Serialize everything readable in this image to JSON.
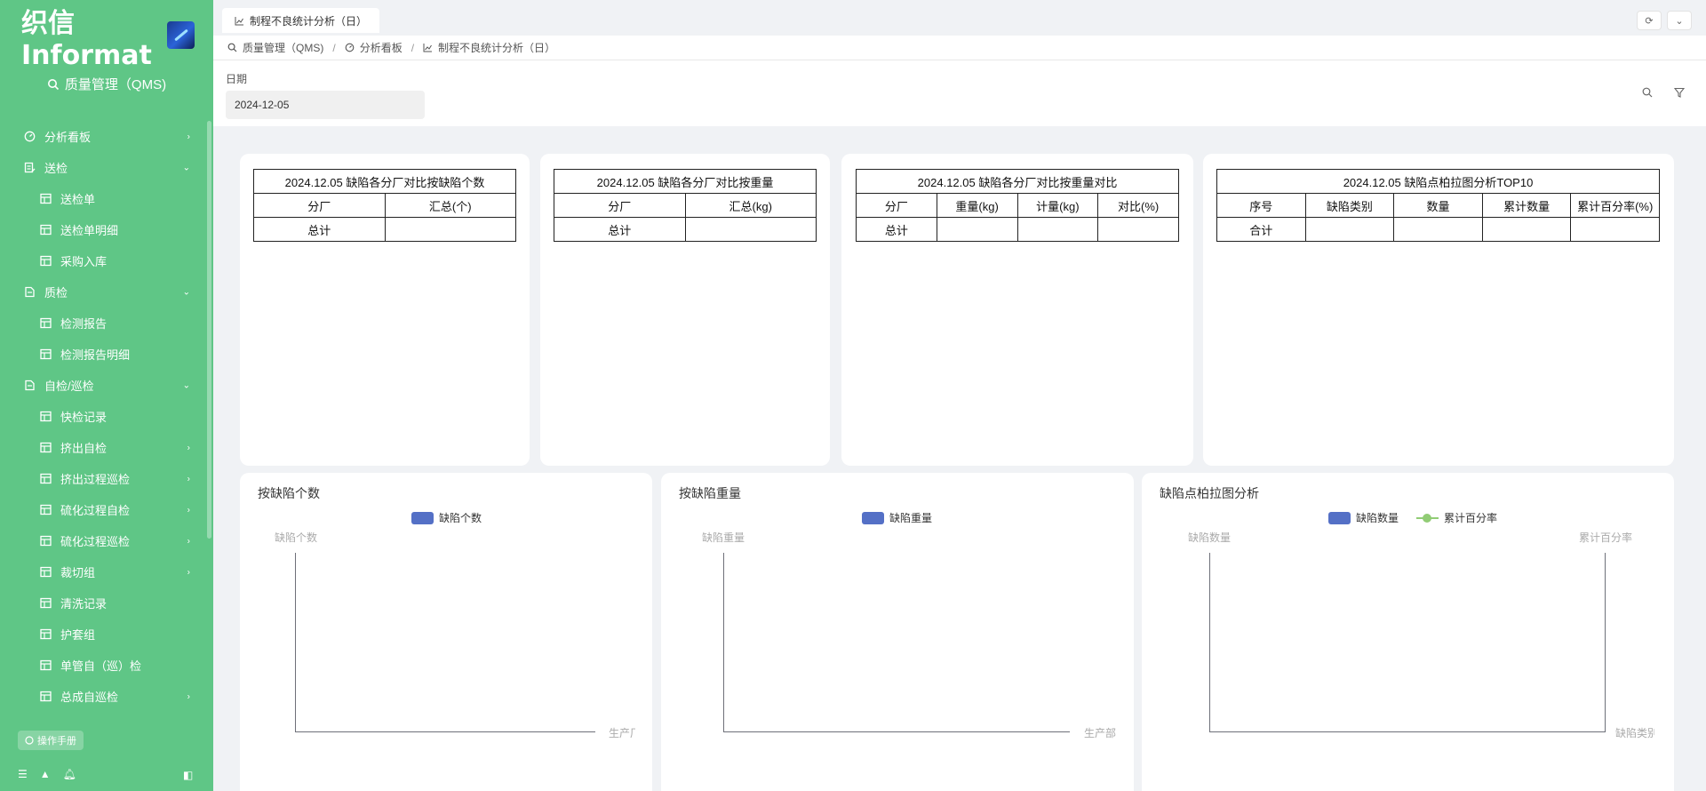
{
  "logo": {
    "text": "织信 Informat"
  },
  "app": {
    "name": "质量管理（QMS)"
  },
  "sidebar": {
    "items": [
      {
        "label": "分析看板",
        "level": 1,
        "arrow": "›",
        "icon": "dashboard-icon"
      },
      {
        "label": "送检",
        "level": 1,
        "arrow": "⌄",
        "icon": "form-icon"
      },
      {
        "label": "送检单",
        "level": 2,
        "arrow": "",
        "icon": "table-icon"
      },
      {
        "label": "送检单明细",
        "level": 2,
        "arrow": "",
        "icon": "table-icon"
      },
      {
        "label": "采购入库",
        "level": 2,
        "arrow": "",
        "icon": "table-icon"
      },
      {
        "label": "质检",
        "level": 1,
        "arrow": "⌄",
        "icon": "doc-icon"
      },
      {
        "label": "检测报告",
        "level": 2,
        "arrow": "",
        "icon": "table-icon"
      },
      {
        "label": "检测报告明细",
        "level": 2,
        "arrow": "",
        "icon": "table-icon"
      },
      {
        "label": "自检/巡检",
        "level": 1,
        "arrow": "⌄",
        "icon": "doc-icon"
      },
      {
        "label": "快检记录",
        "level": 2,
        "arrow": "",
        "icon": "table-icon"
      },
      {
        "label": "挤出自检",
        "level": 2,
        "arrow": "›",
        "icon": "table-icon"
      },
      {
        "label": "挤出过程巡检",
        "level": 2,
        "arrow": "›",
        "icon": "table-icon"
      },
      {
        "label": "硫化过程自检",
        "level": 2,
        "arrow": "›",
        "icon": "table-icon"
      },
      {
        "label": "硫化过程巡检",
        "level": 2,
        "arrow": "›",
        "icon": "table-icon"
      },
      {
        "label": "裁切组",
        "level": 2,
        "arrow": "›",
        "icon": "table-icon"
      },
      {
        "label": "清洗记录",
        "level": 2,
        "arrow": "",
        "icon": "table-icon"
      },
      {
        "label": "护套组",
        "level": 2,
        "arrow": "",
        "icon": "table-icon"
      },
      {
        "label": "单管自（巡）检",
        "level": 2,
        "arrow": "",
        "icon": "table-icon"
      },
      {
        "label": "总成自巡检",
        "level": 2,
        "arrow": "›",
        "icon": "table-icon"
      }
    ],
    "manual_label": "操作手册"
  },
  "tab": {
    "label": "制程不良统计分析（日）"
  },
  "breadcrumb": {
    "items": [
      "质量管理（QMS)",
      "分析看板",
      "制程不良统计分析（日）"
    ],
    "separator": "/"
  },
  "filter": {
    "date_label": "日期",
    "date_value": "2024-12-05"
  },
  "tables": [
    {
      "title": "2024.12.05 缺陷各分厂对比按缺陷个数",
      "headers": [
        "分厂",
        "汇总(个)"
      ],
      "total_row": [
        "总计",
        ""
      ]
    },
    {
      "title": "2024.12.05 缺陷各分厂对比按重量",
      "headers": [
        "分厂",
        "汇总(kg)"
      ],
      "total_row": [
        "总计",
        ""
      ]
    },
    {
      "title": "2024.12.05 缺陷各分厂对比按重量对比",
      "headers": [
        "分厂",
        "重量(kg)",
        "计量(kg)",
        "对比(%)"
      ],
      "total_row": [
        "总计",
        "",
        "",
        ""
      ]
    },
    {
      "title": "2024.12.05 缺陷点柏拉图分析TOP10",
      "headers": [
        "序号",
        "缺陷类别",
        "数量",
        "累计数量",
        "累计百分率(%)"
      ],
      "total_row": [
        "合计",
        "",
        "",
        "",
        ""
      ]
    }
  ],
  "chart_data": [
    {
      "type": "bar",
      "title": "按缺陷个数",
      "categories": [],
      "series": [
        {
          "name": "缺陷个数",
          "values": []
        }
      ],
      "ylabel": "缺陷个数",
      "xlabel": "生产厂",
      "colors": [
        "#5470c6"
      ]
    },
    {
      "type": "bar",
      "title": "按缺陷重量",
      "categories": [],
      "series": [
        {
          "name": "缺陷重量",
          "values": []
        }
      ],
      "ylabel": "缺陷重量",
      "xlabel": "生产部",
      "colors": [
        "#5470c6"
      ]
    },
    {
      "type": "bar",
      "title": "缺陷点柏拉图分析",
      "categories": [],
      "series": [
        {
          "name": "缺陷数量",
          "values": []
        },
        {
          "name": "累计百分率",
          "values": []
        }
      ],
      "ylabel": "缺陷数量",
      "y2label": "累计百分率",
      "xlabel": "缺陷类别",
      "colors": [
        "#5470c6",
        "#91cc75"
      ]
    }
  ]
}
